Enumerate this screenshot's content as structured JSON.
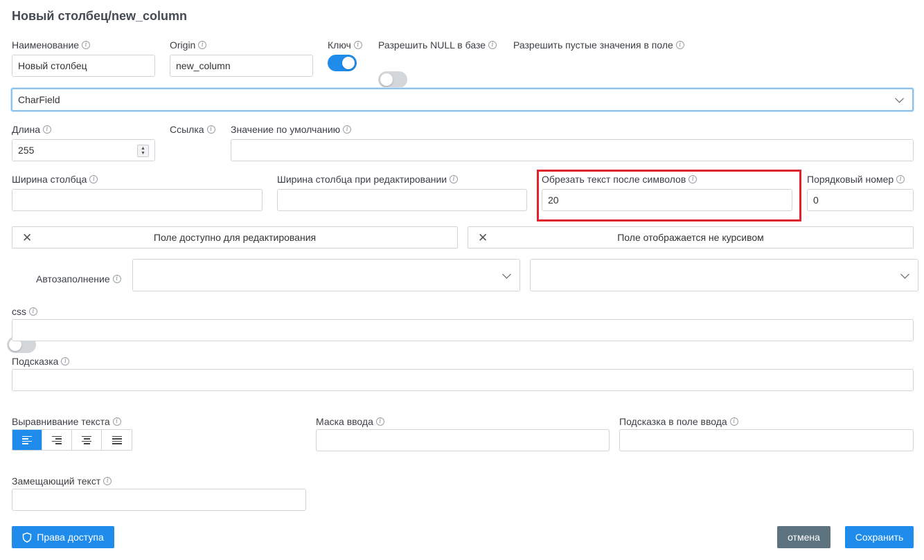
{
  "title": "Новый столбец/new_column",
  "fields": {
    "name": {
      "label": "Наименование",
      "value": "Новый столбец"
    },
    "origin": {
      "label": "Origin",
      "value": "new_column"
    },
    "key": {
      "label": "Ключ",
      "on": true
    },
    "allow_null": {
      "label": "Разрешить NULL в базе",
      "on": false
    },
    "allow_empty": {
      "label": "Разрешить пустые значения в поле",
      "on": false
    },
    "field_type": {
      "value": "CharField"
    },
    "length": {
      "label": "Длина",
      "value": "255"
    },
    "link": {
      "label": "Ссылка",
      "on": false
    },
    "default_value": {
      "label": "Значение по умолчанию",
      "value": ""
    },
    "col_width": {
      "label": "Ширина столбца",
      "value": ""
    },
    "col_width_edit": {
      "label": "Ширина столбца при редактировании",
      "value": ""
    },
    "truncate": {
      "label": "Обрезать текст после символов",
      "value": "20"
    },
    "order": {
      "label": "Порядковый номер",
      "value": "0"
    },
    "editable_btn": {
      "label": "Поле доступно для редактирования"
    },
    "italic_btn": {
      "label": "Поле отображается не курсивом"
    },
    "autofill": {
      "label": "Автозаполнение",
      "on": false
    },
    "css": {
      "label": "css",
      "value": ""
    },
    "hint": {
      "label": "Подсказка",
      "value": ""
    },
    "text_align": {
      "label": "Выравнивание текста",
      "selected": "left"
    },
    "input_mask": {
      "label": "Маска ввода",
      "value": ""
    },
    "input_hint": {
      "label": "Подсказка в поле ввода",
      "value": ""
    },
    "placeholder_text": {
      "label": "Замещающий текст",
      "value": ""
    }
  },
  "buttons": {
    "access": "Права доступа",
    "cancel": "отмена",
    "save": "Сохранить"
  },
  "icons": {
    "info": "info-icon",
    "close": "close-icon",
    "chevron": "chevron-down-icon",
    "shield": "shield-icon"
  },
  "colors": {
    "accent": "#1f8ceb",
    "highlight": "#e0222a",
    "cancel": "#5d7380"
  }
}
